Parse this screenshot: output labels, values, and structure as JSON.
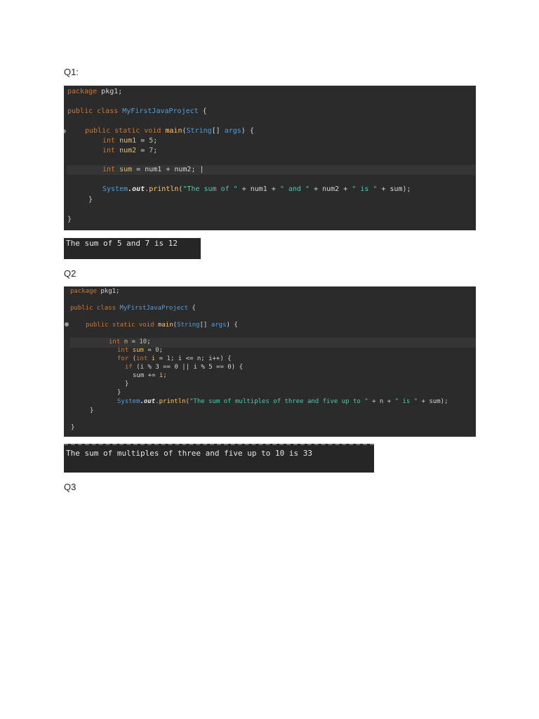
{
  "questions": [
    {
      "label": "Q1:"
    },
    {
      "label": "Q2"
    },
    {
      "label": "Q3"
    }
  ],
  "q1_code": {
    "package": "package",
    "pkg": " pkg1;",
    "public_class": "public class ",
    "class_name": "MyFirstJavaProject",
    "brace_open": " {",
    "main_kw": "public static void ",
    "main_fn": "main",
    "main_paren": "(",
    "string_type": "String",
    "main_args": "[] ",
    "args": "args",
    "main_close": ") {",
    "int": "int ",
    "num1": "num1",
    "eq": " = ",
    "v5": "5",
    "semi": ";",
    "num2": "num2",
    "v7": "7",
    "sum_var": "sum",
    "sum_expr": " = num1 + num2; |",
    "system": "System",
    "dot_out": ".out",
    "println": ".println(",
    "str1": "\"The sum of \"",
    "plus_num1": " + num1 + ",
    "str2": "\" and \"",
    "plus_num2": " + num2 + ",
    "str3": "\" is \"",
    "plus_sum": " + sum);",
    "close_inner": "}",
    "close_outer": "}"
  },
  "q1_output": "The sum of 5 and 7 is 12",
  "q2_code": {
    "package": "package",
    "pkg": " pkg1;",
    "public_class": "public class ",
    "class_name": "MyFirstJavaProject",
    "brace_open": " {",
    "main_kw": "public static void ",
    "main_fn": "main",
    "main_paren": "(",
    "string_type": "String",
    "main_args": "[] ",
    "args": "args",
    "main_close": ") {",
    "int": "int ",
    "n": "n",
    "eq": " = ",
    "v10": "10",
    "semi": ";",
    "sum": "sum",
    "v0": "0",
    "for_kw": "for ",
    "for_paren": "(",
    "i": "i",
    "v1": "1",
    "for_cond": "; i <= n; i++) {",
    "if_kw": "if ",
    "if_cond": "(i % 3 == 0 || i % 5 == 0) {",
    "sum_add": "sum += ",
    "i_semi": "i;",
    "close_if": "}",
    "close_for": "}",
    "system": "System",
    "dot_out": ".out",
    "println": ".println(",
    "str1": "\"The sum of multiples of three and five up to \"",
    "plus_n": " + n + ",
    "str2": "\" is \"",
    "plus_sum": " + sum);",
    "close_inner": "}",
    "close_outer": "}"
  },
  "q2_output": "The sum of multiples of three and five up to 10 is 33",
  "colors": {
    "editor_bg": "#2b2b2b",
    "keyword": "#cc7832",
    "class": "#4f9fe0",
    "string": "#4ec9b0"
  }
}
